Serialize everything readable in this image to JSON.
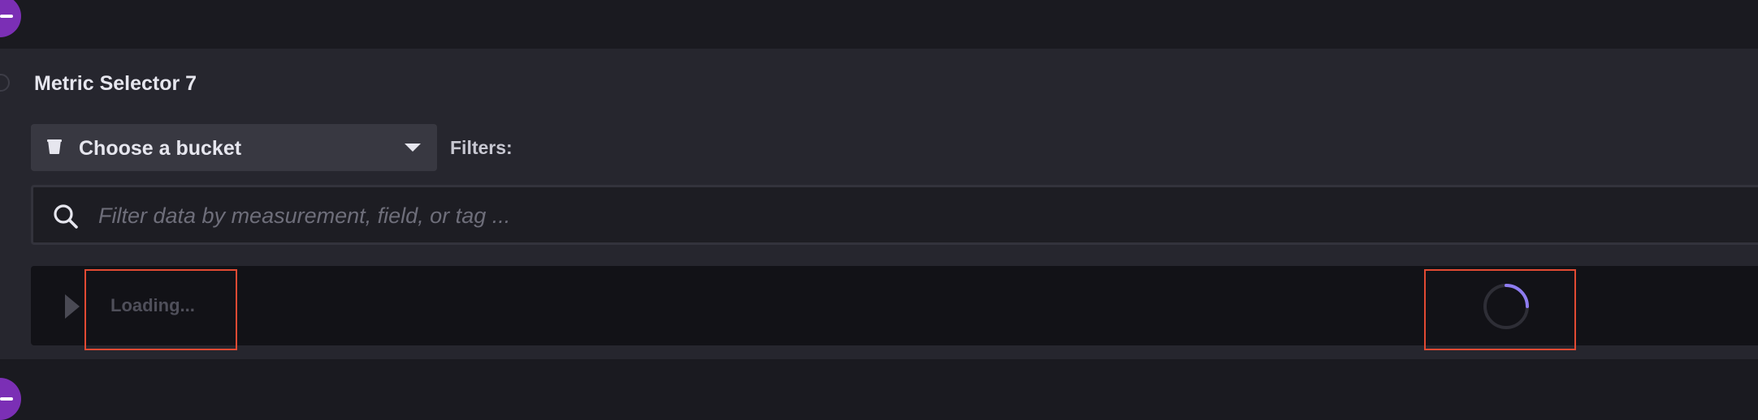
{
  "panel": {
    "title": "Metric Selector 7"
  },
  "bucket": {
    "label": "Choose a bucket",
    "icon": "bucket-icon"
  },
  "filters": {
    "label": "Filters:"
  },
  "search": {
    "placeholder": "Filter data by measurement, field, or tag ...",
    "value": "",
    "icon": "search-icon"
  },
  "tree": {
    "loading_label": "Loading...",
    "expand_icon": "caret-right-icon",
    "spinner_icon": "spinner-icon"
  },
  "colors": {
    "accent": "#7b2fb5",
    "spinner": "#8e7cf0",
    "highlight": "#e24a33"
  }
}
